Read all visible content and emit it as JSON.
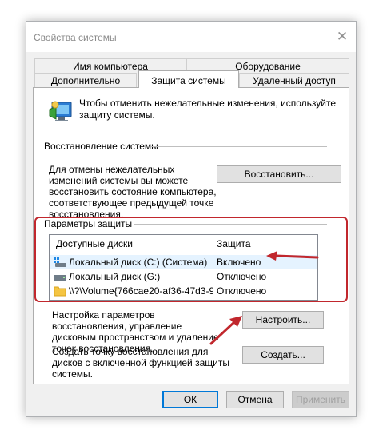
{
  "window": {
    "title": "Свойства системы"
  },
  "tabs_row1": [
    {
      "label": "Имя компьютера"
    },
    {
      "label": "Оборудование"
    }
  ],
  "tabs_row2": [
    {
      "label": "Дополнительно"
    },
    {
      "label": "Защита системы"
    },
    {
      "label": "Удаленный доступ"
    }
  ],
  "intro": {
    "text": "Чтобы отменить нежелательные изменения, используйте защиту системы."
  },
  "restore": {
    "section_title": "Восстановление системы",
    "description": "Для отмены нежелательных изменений системы вы можете восстановить состояние компьютера, соответствующее предыдущей точке восстановления.",
    "button": "Восстановить..."
  },
  "protection": {
    "section_title": "Параметры защиты",
    "columns": {
      "drives": "Доступные диски",
      "protection": "Защита"
    },
    "rows": [
      {
        "drive": "Локальный диск (C:) (Система)",
        "status": "Включено",
        "icon": "system-drive-icon"
      },
      {
        "drive": "Локальный диск (G:)",
        "status": "Отключено",
        "icon": "drive-icon"
      },
      {
        "drive": "\\\\?\\Volume{766cae20-af36-47d3-9...",
        "status": "Отключено",
        "icon": "folder-icon"
      }
    ]
  },
  "configure": {
    "text": "Настройка параметров восстановления, управление дисковым пространством и удаление точек восстановления.",
    "button": "Настроить..."
  },
  "create": {
    "text": "Создать точку восстановления для дисков с включенной функцией защиты системы.",
    "button": "Создать..."
  },
  "footer": {
    "ok": "ОК",
    "cancel": "Отмена",
    "apply": "Применить"
  },
  "colors": {
    "highlight_red": "#c1272d",
    "selected_row": "#e5f3ff",
    "accent": "#0078d7"
  }
}
